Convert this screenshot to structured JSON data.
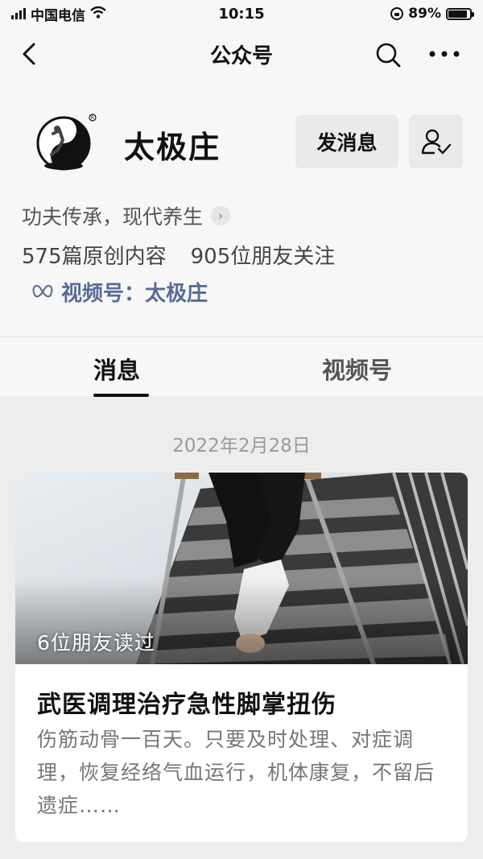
{
  "status_bar": {
    "carrier": "中国电信",
    "time": "10:15",
    "battery": "89%",
    "battery_level": 0.89
  },
  "nav": {
    "title": "公众号"
  },
  "profile": {
    "name": "太极庄",
    "send_message_label": "发消息",
    "bio": "功夫传承，现代养生",
    "stats_original": "575篇原创内容",
    "stats_followers": "905位朋友关注",
    "channel_link": "视频号：太极庄"
  },
  "tabs": [
    {
      "label": "消息",
      "active": true
    },
    {
      "label": "视频号",
      "active": false
    }
  ],
  "feed": {
    "date": "2022年2月28日",
    "article": {
      "read_count": "6位朋友读过",
      "title": "武医调理治疗急性脚掌扭伤",
      "summary": "伤筋动骨一百天。只要及时处理、对症调理，恢复经络气血运行，机体康复，不留后遗症……"
    }
  },
  "colors": {
    "link": "#576b95",
    "background": "#ededed",
    "panel": "#f7f7f7",
    "button": "#eaeaea"
  },
  "icons": [
    "back-chevron-icon",
    "search-icon",
    "more-icon",
    "follow-check-icon",
    "chevron-right-icon",
    "channels-butterfly-icon"
  ]
}
